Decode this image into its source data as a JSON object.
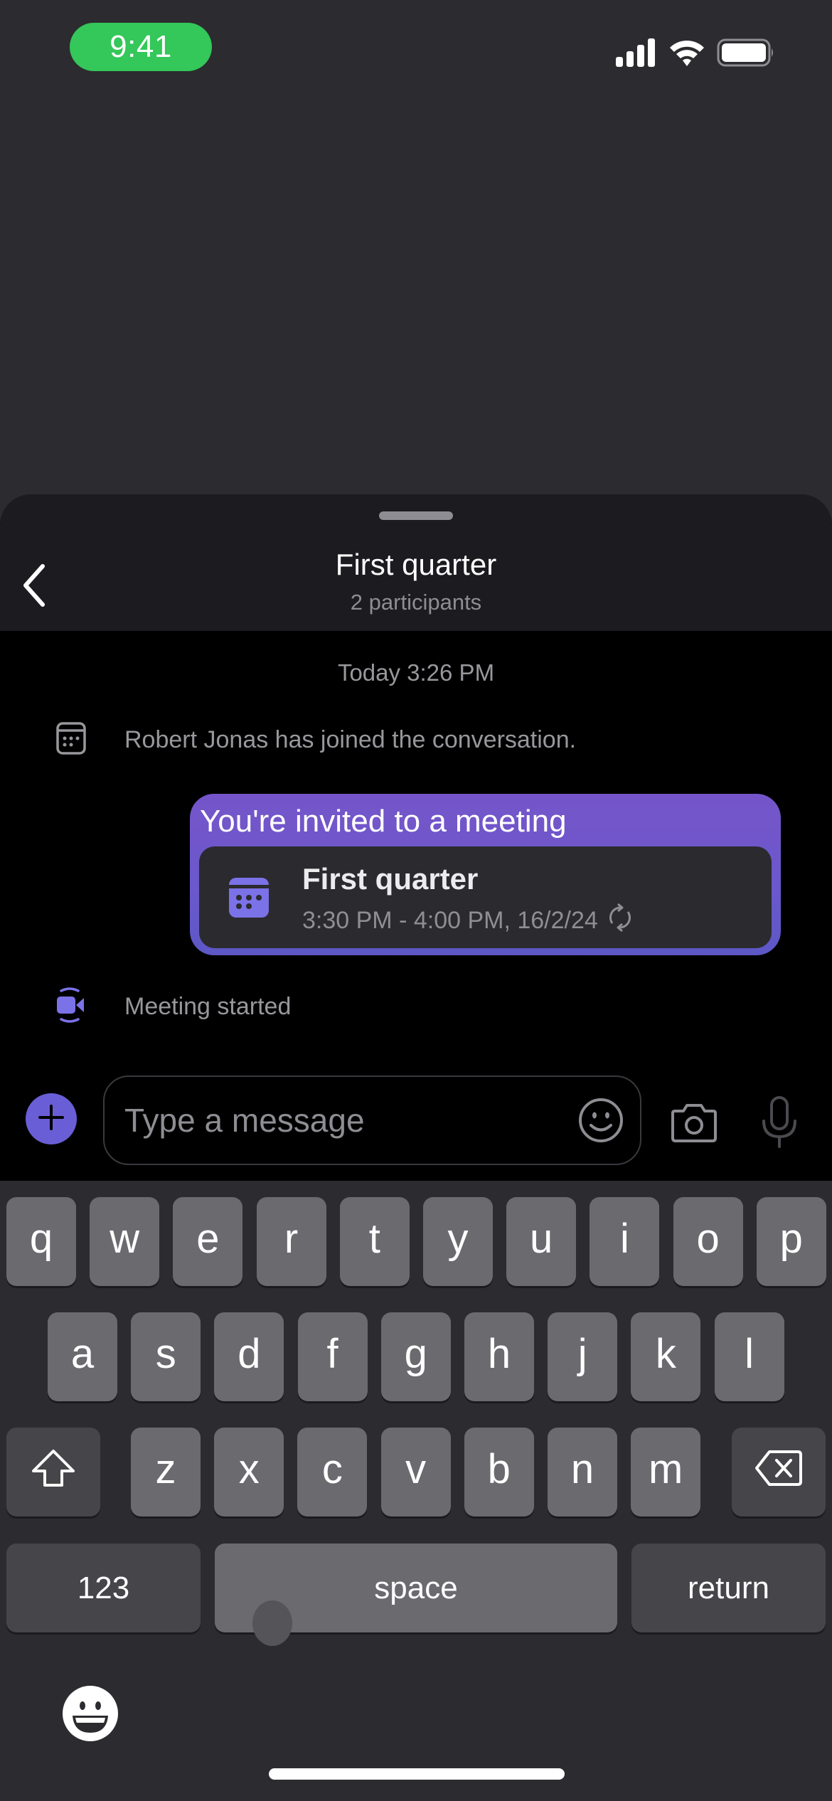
{
  "status_bar": {
    "time": "9:41",
    "time_pill_color": "#34c759",
    "icons": [
      "cellular-signal-icon",
      "wifi-icon",
      "battery-icon"
    ]
  },
  "header": {
    "title": "First quarter",
    "subtitle": "2 participants",
    "back_icon": "chevron-left-icon"
  },
  "conversation": {
    "timestamp": "Today 3:26 PM",
    "system_messages": [
      {
        "icon": "calendar-icon",
        "text": "Robert Jonas has joined the conversation."
      },
      {
        "icon": "video-call-icon",
        "text": "Meeting started"
      }
    ],
    "invite_bubble": {
      "heading": "You're invited to a meeting",
      "meeting_title": "First quarter",
      "meeting_time": "3:30 PM - 4:00 PM, 16/2/24",
      "recurring_icon": "recurring-icon",
      "accent_color": "#6a58cc"
    }
  },
  "composer": {
    "placeholder": "Type a message",
    "value": "",
    "add_icon": "plus-icon",
    "emoji_icon": "smiley-icon",
    "camera_icon": "camera-icon",
    "mic_icon": "microphone-icon"
  },
  "keyboard": {
    "row1": [
      "q",
      "w",
      "e",
      "r",
      "t",
      "y",
      "u",
      "i",
      "o",
      "p"
    ],
    "row2": [
      "a",
      "s",
      "d",
      "f",
      "g",
      "h",
      "j",
      "k",
      "l"
    ],
    "row3": [
      "z",
      "x",
      "c",
      "v",
      "b",
      "n",
      "m"
    ],
    "shift_icon": "shift-icon",
    "delete_icon": "backspace-icon",
    "numbers_label": "123",
    "space_label": "space",
    "return_label": "return",
    "emoji_icon": "emoji-keyboard-icon"
  }
}
